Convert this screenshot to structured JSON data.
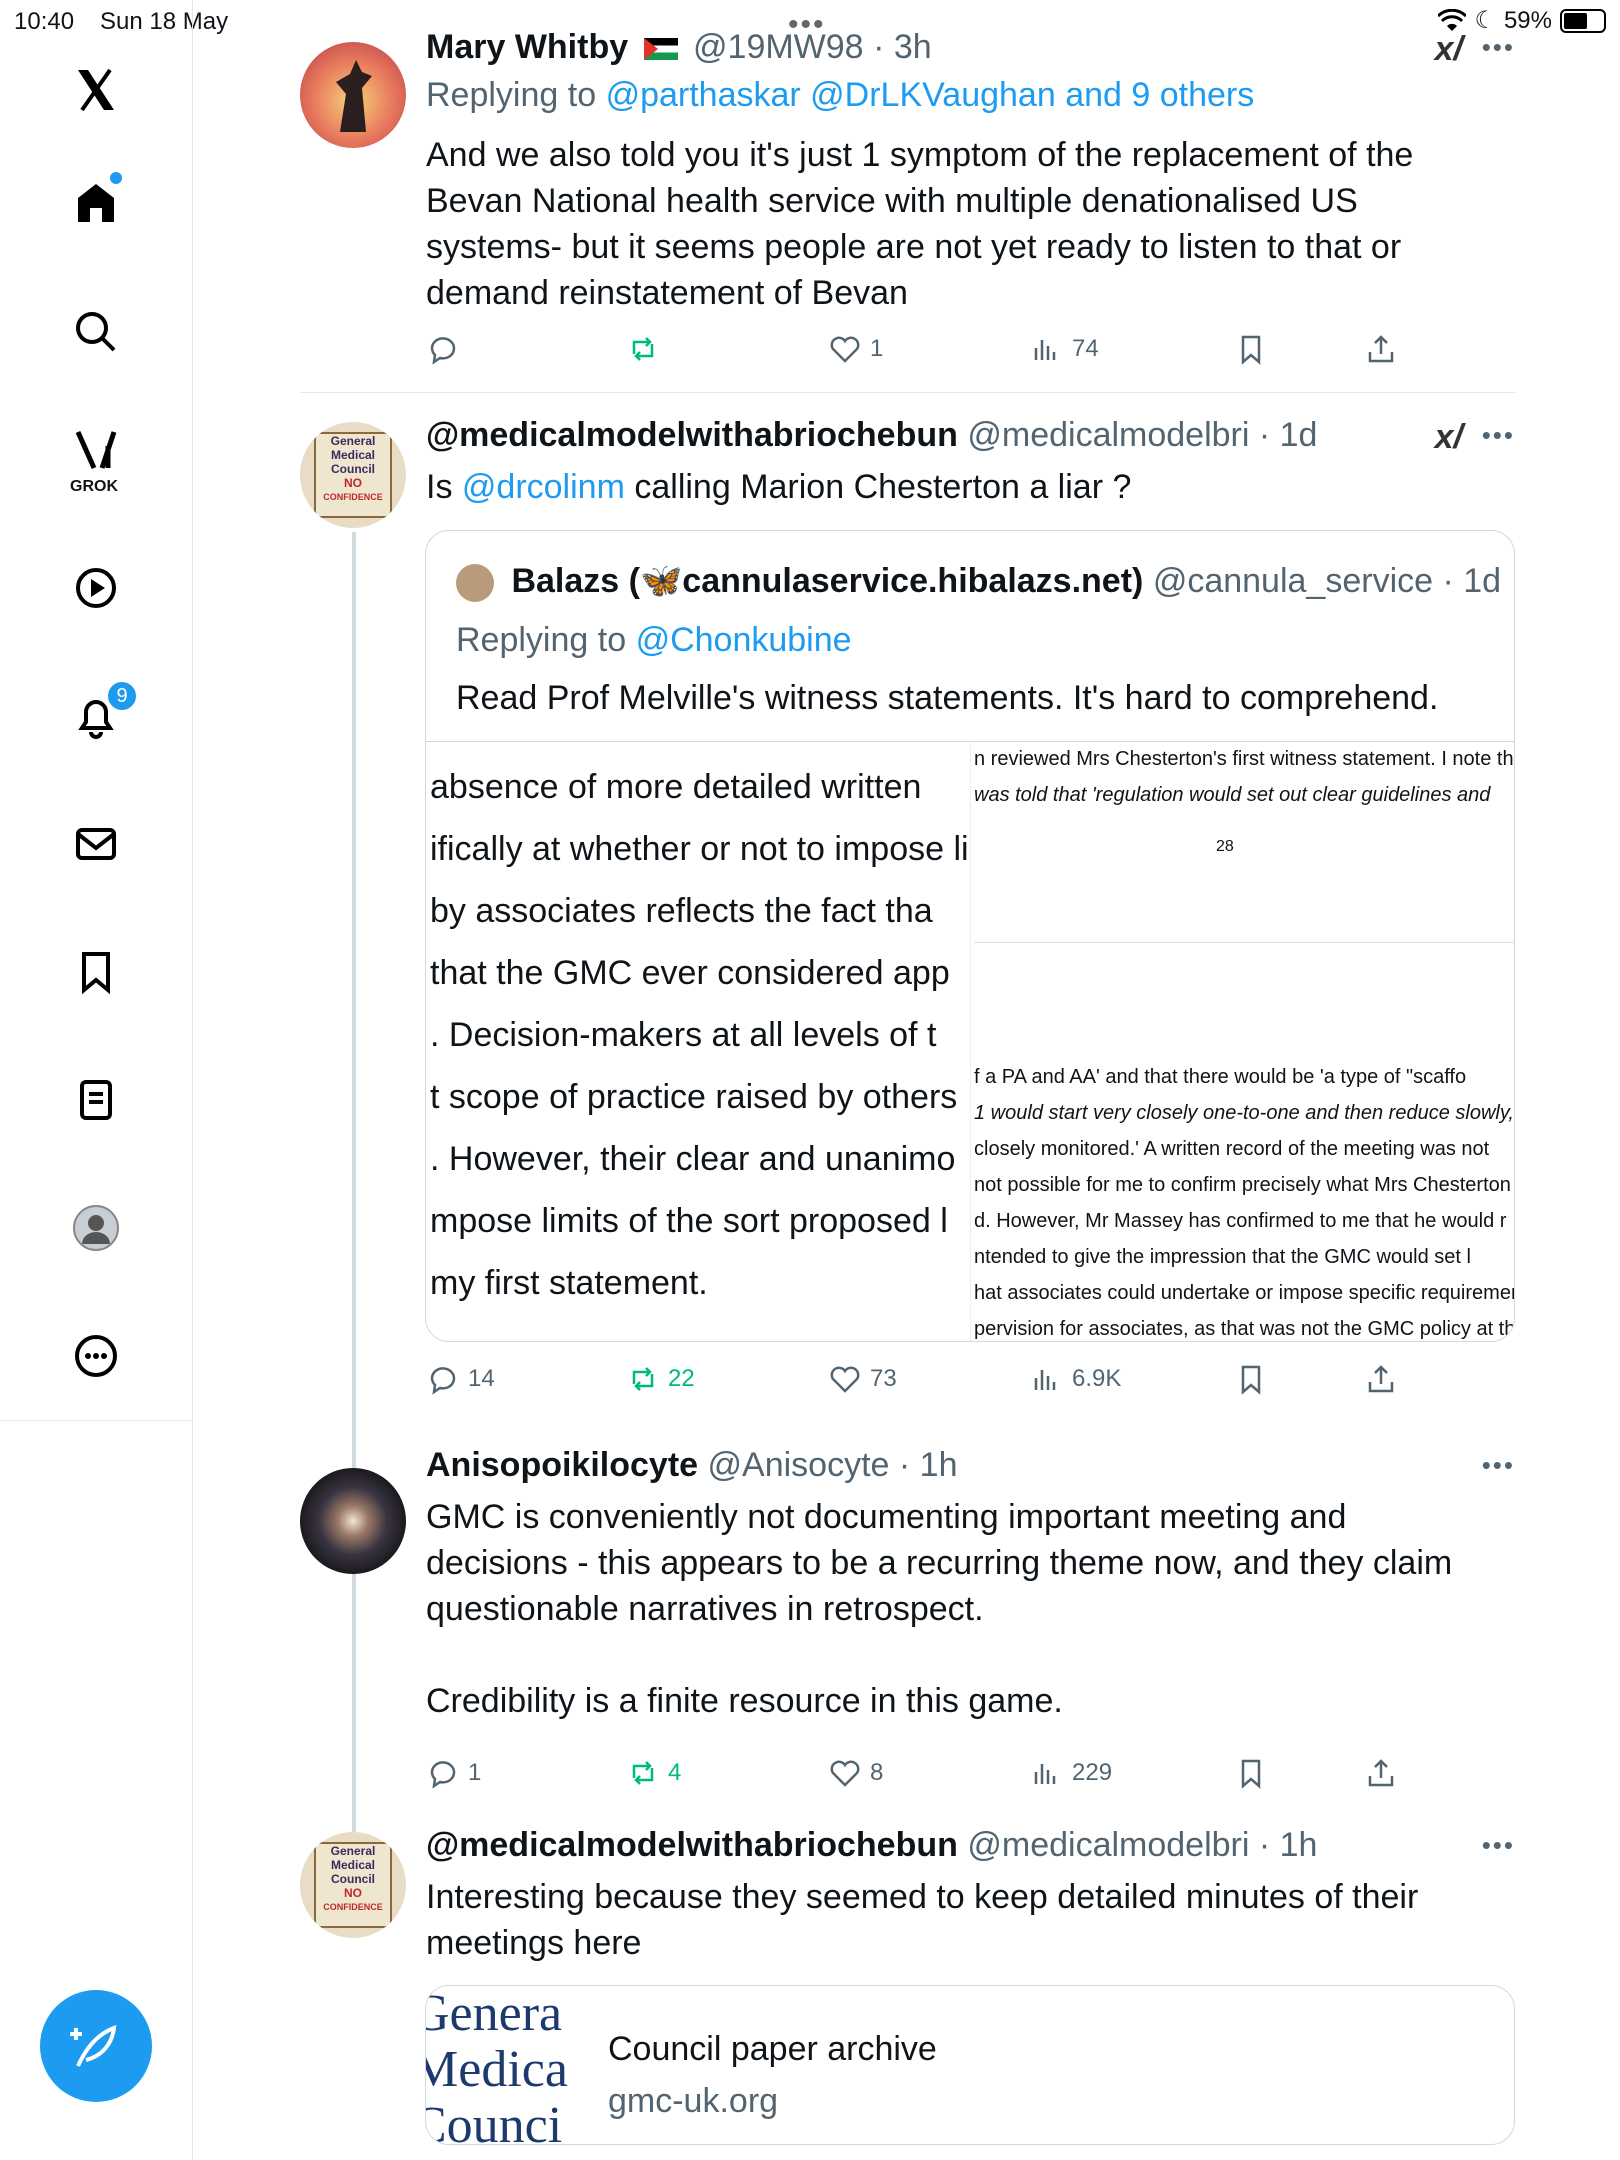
{
  "status": {
    "time": "10:40",
    "date": "Sun 18 May",
    "battery": "59%"
  },
  "sidebar": {
    "grok_label": "GROK",
    "notifications_badge": "9"
  },
  "tweets": [
    {
      "name": "Mary Whitby",
      "handle": "@19MW98",
      "time": "· 3h",
      "replying_prefix": "Replying to",
      "replying_to": "@parthaskar @DrLKVaughan and 9 others",
      "body": "And we also told you it's just 1 symptom of the replacement of the Bevan National health service with multiple denationalised US systems- but it seems people are not yet ready to listen to that or demand reinstatement of Bevan",
      "replies": "",
      "reposts": "",
      "likes": "1",
      "views": "74"
    },
    {
      "name": "@medicalmodelwithabriochebun",
      "handle": "@medicalmodelbri",
      "time": "· 1d",
      "body_prefix": "Is",
      "body_mention": "@drcolinm",
      "body_suffix": "calling Marion Chesterton a liar ?",
      "quote": {
        "name": "Balazs (🦋cannulaservice.hibalazs.net)",
        "handle": "@cannula_service",
        "time": "· 1d",
        "replying_prefix": "Replying to",
        "replying_to": "@Chonkubine",
        "body": "Read Prof Melville's witness statements. It's hard to comprehend.",
        "doc_left": [
          "absence  of  more  detailed  written",
          "ifically at whether or not to impose lir",
          " by  associates  reflects  the  fact  tha",
          "that  the  GMC  ever  considered  app",
          ".  Decision-makers  at  all  levels  of  t",
          "t scope of practice raised by others",
          ".  However,  their  clear  and  unanimo",
          "mpose  limits  of  the  sort  proposed  l",
          "my first statement."
        ],
        "doc_right": [
          "n reviewed Mrs Chesterton's first witness statement. I note th",
          " was told that 'regulation would set out clear guidelines and",
          "28",
          "f a PA and AA' and that there would be 'a type of \"scaffo",
          "1 would start very closely one-to-one and then reduce slowly,",
          "closely monitored.' A written record of the meeting was not",
          "not possible for me to confirm precisely what Mrs Chesterton",
          "d. However, Mr Massey has confirmed to me that he would r",
          "ntended to give the impression that the GMC would set l",
          "hat associates could undertake or impose specific requiremen",
          "pervision for associates, as that was not the GMC policy at th"
        ]
      },
      "replies": "14",
      "reposts": "22",
      "likes": "73",
      "views": "6.9K"
    },
    {
      "name": "Anisopoikilocyte",
      "handle": "@Anisocyte",
      "time": "· 1h",
      "body": "GMC is conveniently not documenting important meeting and decisions - this appears to be a recurring theme now, and they claim questionable narratives in retrospect.",
      "body2": "Credibility is a finite resource in this game.",
      "replies": "1",
      "reposts": "4",
      "likes": "8",
      "views": "229"
    },
    {
      "name": "@medicalmodelwithabriochebun",
      "handle": "@medicalmodelbri",
      "time": "· 1h",
      "body": "Interesting because they seemed to keep detailed minutes of their meetings here",
      "card": {
        "thumb_lines": [
          "Genera",
          "Medica",
          "Counci"
        ],
        "title": "Council paper archive",
        "domain": "gmc-uk.org"
      }
    }
  ],
  "avatar_text": {
    "line1": "General",
    "line2": "Medical",
    "line3": "Council",
    "line4": "NO",
    "line5": "CONFIDENCE"
  },
  "colors": {
    "accent": "#1d9bf0",
    "repost_green": "#00ba7c",
    "muted": "#536471"
  }
}
